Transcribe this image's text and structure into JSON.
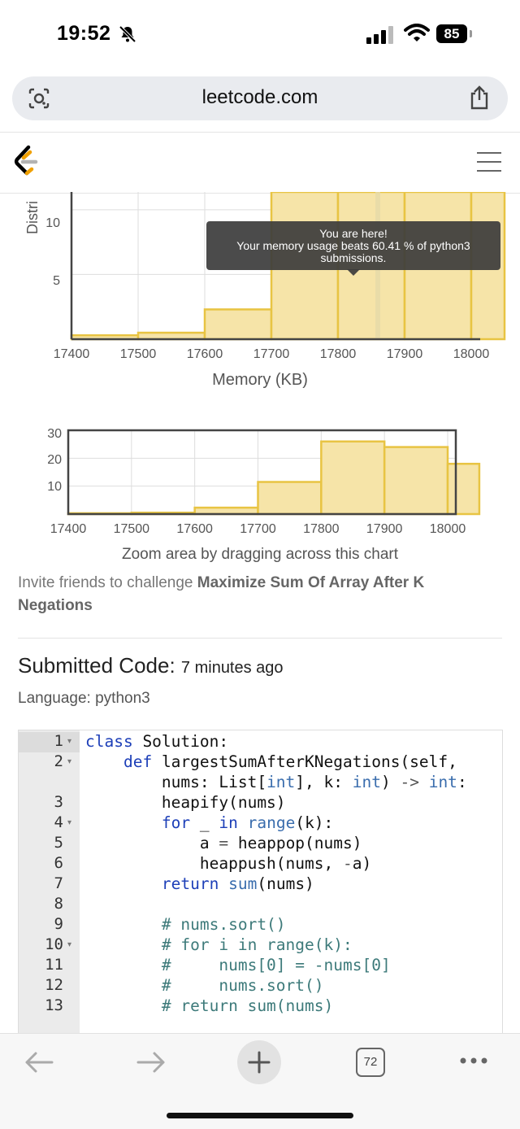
{
  "status": {
    "time": "19:52",
    "battery": "85"
  },
  "browser": {
    "url": "leetcode.com",
    "tabs_count": "72"
  },
  "main_chart": {
    "ylabel_partial": "Distri",
    "yticks": [
      "10",
      "5"
    ],
    "xticks": [
      "17400",
      "17500",
      "17600",
      "17700",
      "17800",
      "17900",
      "18000"
    ],
    "xlabel": "Memory (KB)",
    "tooltip": {
      "line1": "You are here!",
      "line2": "Your memory usage beats 60.41 % of python3",
      "line3": "submissions."
    }
  },
  "zoom_chart": {
    "yticks": [
      "30",
      "20",
      "10"
    ],
    "xticks": [
      "17400",
      "17500",
      "17600",
      "17700",
      "17800",
      "17900",
      "18000"
    ],
    "hint": "Zoom area by dragging across this chart"
  },
  "chart_data": [
    {
      "type": "bar",
      "xlabel": "Memory (KB)",
      "ylabel": "Distri",
      "x": [
        17400,
        17500,
        17600,
        17700,
        17800,
        17900,
        18000
      ],
      "bins": [
        [
          17400,
          17500
        ],
        [
          17500,
          17600
        ],
        [
          17600,
          17700
        ],
        [
          17700,
          17800
        ],
        [
          17800,
          17900
        ],
        [
          17900,
          18000
        ],
        [
          18000,
          18050
        ]
      ],
      "values": [
        0.3,
        0.5,
        2.3,
        11.5,
        26,
        24,
        18
      ],
      "ylim": [
        0,
        12
      ],
      "grid": true,
      "marker_value": 17850
    },
    {
      "type": "bar",
      "x": [
        17400,
        17500,
        17600,
        17700,
        17800,
        17900,
        18000
      ],
      "bins": [
        [
          17400,
          17500
        ],
        [
          17500,
          17600
        ],
        [
          17600,
          17700
        ],
        [
          17700,
          17800
        ],
        [
          17800,
          17900
        ],
        [
          17900,
          18000
        ],
        [
          18000,
          18050
        ]
      ],
      "values": [
        0.3,
        0.5,
        2.3,
        11.5,
        26,
        24,
        18
      ],
      "ylim": [
        0,
        30
      ],
      "grid": true
    }
  ],
  "invite": {
    "prefix": "Invite friends to challenge ",
    "problem": "Maximize Sum Of Array After K Negations"
  },
  "submission": {
    "title": "Submitted Code:",
    "ago": "7 minutes ago",
    "language": "Language: python3"
  },
  "code_lines": [
    {
      "n": "1",
      "fold": true
    },
    {
      "n": "2",
      "fold": true
    },
    {
      "n": "",
      "fold": false
    },
    {
      "n": "3",
      "fold": false
    },
    {
      "n": "4",
      "fold": true
    },
    {
      "n": "5",
      "fold": false
    },
    {
      "n": "6",
      "fold": false
    },
    {
      "n": "7",
      "fold": false
    },
    {
      "n": "8",
      "fold": false
    },
    {
      "n": "9",
      "fold": false
    },
    {
      "n": "10",
      "fold": true
    },
    {
      "n": "11",
      "fold": false
    },
    {
      "n": "12",
      "fold": false
    },
    {
      "n": "13",
      "fold": false
    }
  ],
  "code": {
    "l1": [
      "class",
      " Solution:"
    ],
    "l2": [
      "    ",
      "def",
      " largestSumAfterKNegations(self,"
    ],
    "l2b": [
      "        nums: List[",
      "int",
      "], k: ",
      "int",
      ") ",
      "->",
      " ",
      "int",
      ":"
    ],
    "l3": [
      "        heapify(nums)"
    ],
    "l4": [
      "        ",
      "for",
      " _ ",
      "in",
      " ",
      "range",
      "(k):"
    ],
    "l5": [
      "            a ",
      "=",
      " heappop(nums)"
    ],
    "l6": [
      "            heappush(nums, ",
      "-",
      "a)"
    ],
    "l7": [
      "        ",
      "return",
      " ",
      "sum",
      "(nums)"
    ],
    "l9": "        # nums.sort()",
    "l10": "        # for i in range(k):",
    "l11": "        #     nums[0] = -nums[0]",
    "l12": "        #     nums.sort()",
    "l13": "        # return sum(nums)"
  },
  "colors": {
    "bar_fill": "#f6e4a8",
    "bar_stroke": "#e8c443",
    "keyword": "#1d3fb8",
    "comment": "#3d7a7a"
  }
}
